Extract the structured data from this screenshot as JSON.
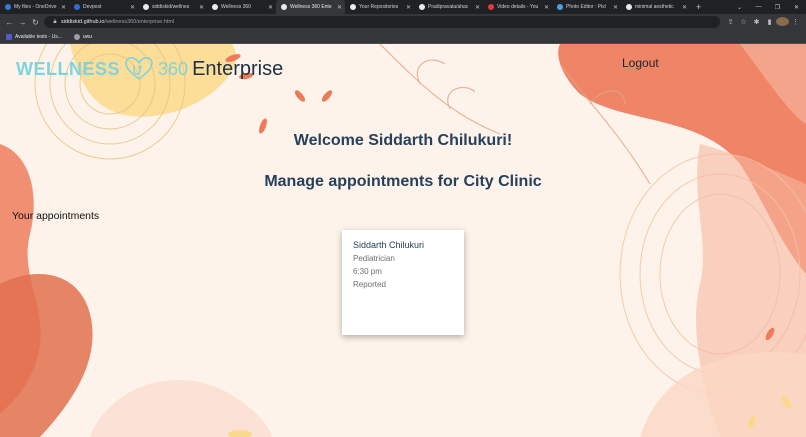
{
  "browser": {
    "tabs": [
      {
        "label": "My files - OneDrive",
        "favicon_color": "#2f7fd8",
        "active": false
      },
      {
        "label": "Devpost",
        "favicon_color": "#2f6fd6",
        "active": false
      },
      {
        "label": "siddiskid/wellnes",
        "favicon_color": "#e8eaed",
        "active": false
      },
      {
        "label": "Wellness 360",
        "favicon_color": "#e8eaed",
        "active": false
      },
      {
        "label": "Wellness 360 Ente",
        "favicon_color": "#e8eaed",
        "active": true
      },
      {
        "label": "Your Repositories",
        "favicon_color": "#e8eaed",
        "active": false
      },
      {
        "label": "Pradipravala/ahac",
        "favicon_color": "#e8eaed",
        "active": false
      },
      {
        "label": "Video details - You",
        "favicon_color": "#e53935",
        "active": false
      },
      {
        "label": "Photo Editor : Pixl",
        "favicon_color": "#4aa3e8",
        "active": false
      },
      {
        "label": "minimal aesthetic",
        "favicon_color": "#e8eaed",
        "active": false
      }
    ],
    "url_host": "siddiskid.github.io",
    "url_path": "/wellness360/enterprise.html",
    "bookmarks": [
      {
        "label": "Available tests - Us...",
        "icon_color": "#4f5bd5"
      },
      {
        "label": "uwu",
        "icon_color": "#9aa0a6"
      }
    ]
  },
  "header": {
    "logo_wellness": "WELLNESS",
    "logo_360": "360",
    "logo_enterprise": "Enterprise",
    "logout_label": "Logout"
  },
  "main": {
    "welcome": "Welcome Siddarth Chilukuri!",
    "manage": "Manage appointments for City Clinic",
    "appointments_heading": "Your appointments",
    "appointments": [
      {
        "doctor": "Siddarth Chilukuri",
        "specialty": "Pediatrician",
        "time": "6:30 pm",
        "status": "Reported"
      }
    ]
  },
  "colors": {
    "accent_teal": "#7fd3dd",
    "heading_navy": "#27405c",
    "blob_orange": "#f08466",
    "blob_yellow": "#fbd98a"
  }
}
